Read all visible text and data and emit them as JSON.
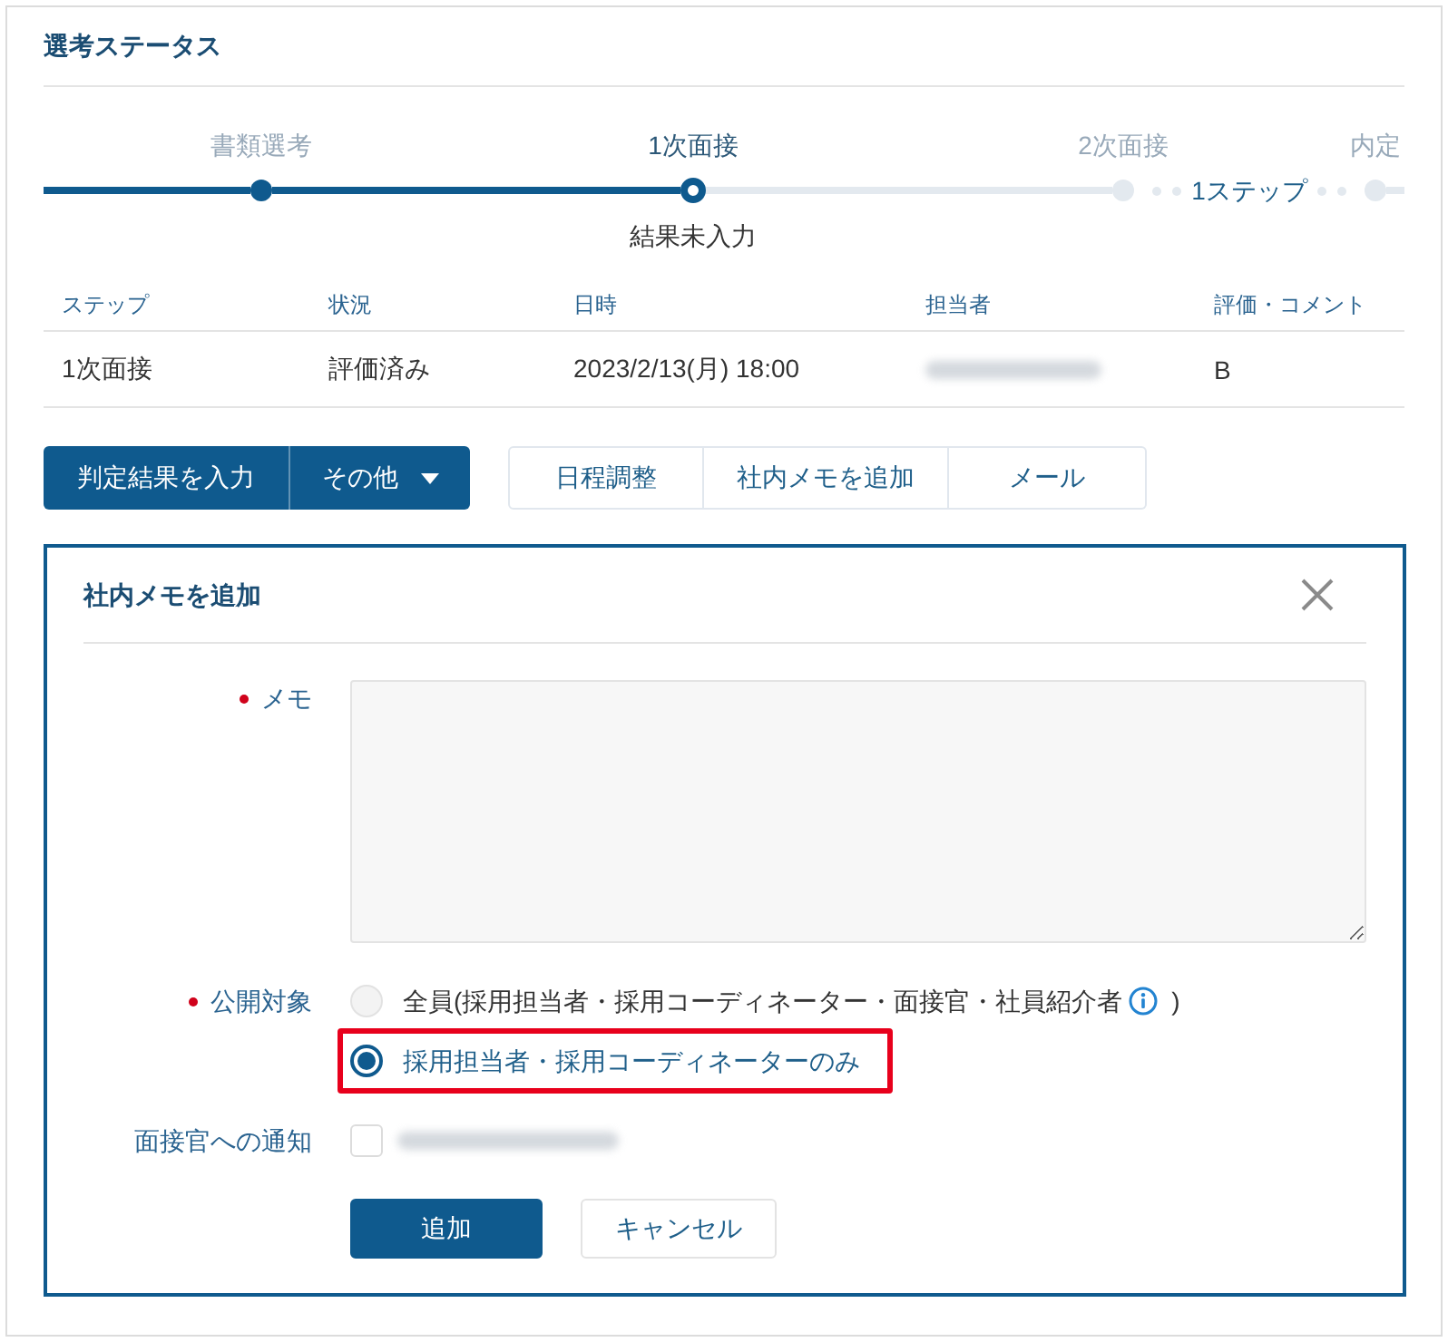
{
  "status_section": {
    "title": "選考ステータス"
  },
  "stepper": {
    "steps": [
      {
        "label": "書類選考",
        "kind": "done"
      },
      {
        "label": "1次面接",
        "kind": "current",
        "note": "結果未入力"
      },
      {
        "label": "2次面接",
        "kind": "upcoming"
      },
      {
        "label": "内定",
        "kind": "upcoming",
        "gap_label": "1ステップ"
      }
    ]
  },
  "table": {
    "columns": [
      "ステップ",
      "状況",
      "日時",
      "担当者",
      "評価・コメント"
    ],
    "rows": [
      [
        {
          "kind": "text",
          "text": "1次面接"
        },
        {
          "kind": "text",
          "text": "評価済み"
        },
        {
          "kind": "text",
          "text": "2023/2/13(月) 18:00"
        },
        {
          "kind": "blurred"
        },
        {
          "kind": "text",
          "text": "B"
        }
      ]
    ]
  },
  "actions": {
    "primary": [
      {
        "label": "判定結果を入力",
        "dropdown": false
      },
      {
        "label": "その他",
        "dropdown": true
      }
    ],
    "secondary": [
      "日程調整",
      "社内メモを追加",
      "メール"
    ]
  },
  "memo_panel": {
    "title": "社内メモを追加",
    "fields": [
      {
        "kind": "textarea",
        "label": "メモ",
        "required": true
      },
      {
        "kind": "radio",
        "label": "公開対象",
        "required": true,
        "options": [
          {
            "label": "全員(採用担当者・採用コーディネーター・面接官・社員紹介者",
            "info": true,
            "suffix": ")",
            "selected": false,
            "highlighted": false
          },
          {
            "label": "採用担当者・採用コーディネーターのみ",
            "info": false,
            "selected": true,
            "highlighted": true
          }
        ]
      },
      {
        "kind": "checkbox",
        "label": "面接官への通知",
        "required": false,
        "checked": false
      }
    ],
    "buttons": [
      {
        "label": "追加",
        "kind": "primary"
      },
      {
        "label": "キャンセル",
        "kind": "secondary"
      }
    ]
  }
}
